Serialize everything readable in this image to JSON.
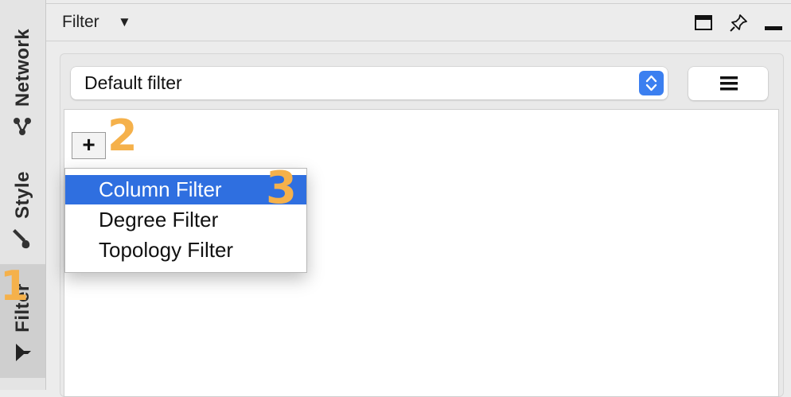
{
  "sidebar": {
    "tabs": [
      {
        "label": "Network",
        "icon": "network-icon"
      },
      {
        "label": "Style",
        "icon": "brush-icon"
      },
      {
        "label": "Filter",
        "icon": "filter-icon",
        "active": true
      }
    ]
  },
  "header": {
    "title": "Filter",
    "caret": "▼",
    "buttons": [
      "maximize-icon",
      "pin-icon",
      "minimize-icon"
    ]
  },
  "filter_select": {
    "value": "Default filter"
  },
  "add_button": {
    "label": "+"
  },
  "popup_menu": {
    "items": [
      {
        "label": "Column Filter",
        "selected": true
      },
      {
        "label": "Degree Filter"
      },
      {
        "label": "Topology Filter"
      }
    ]
  },
  "step_markers": [
    "1",
    "2",
    "3"
  ],
  "colors": {
    "accent": "#3b7ff0",
    "selection": "#2f6fe0",
    "step_marker": "#f5b14b"
  }
}
